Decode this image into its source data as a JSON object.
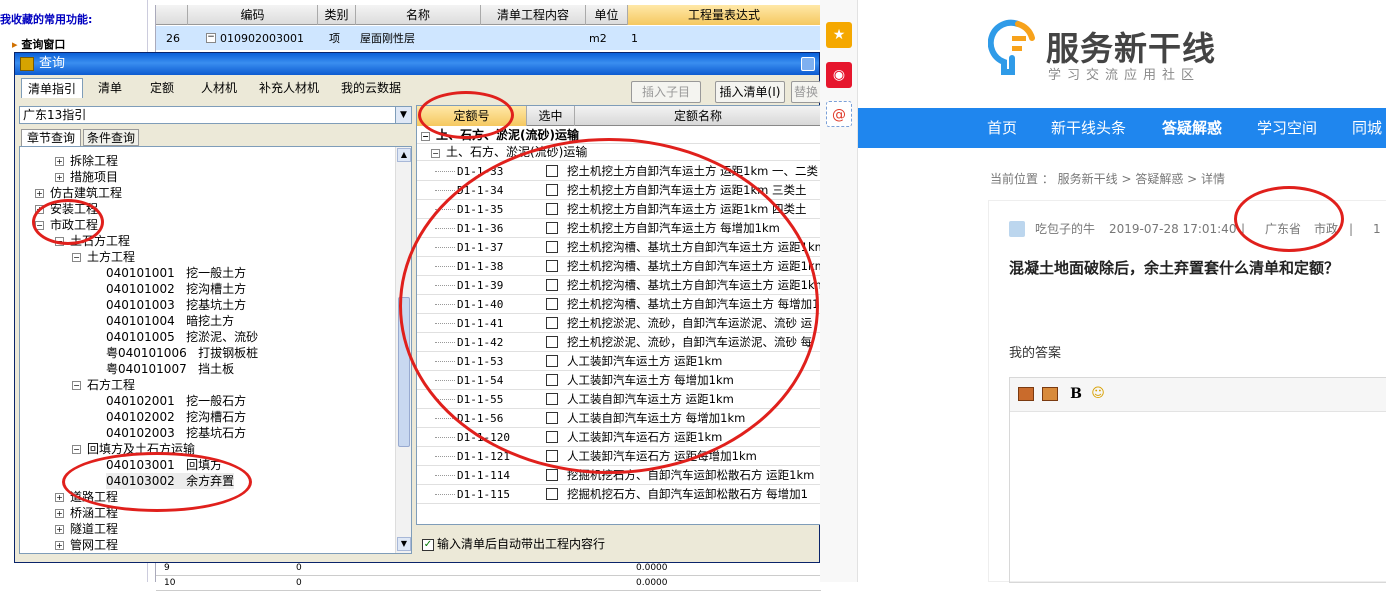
{
  "sidebar": {
    "favorites_title": "我收藏的常用功能:",
    "item": "查询窗口"
  },
  "bg_sheet": {
    "columns": [
      "编码",
      "类别",
      "名称",
      "清单工程内容",
      "单位",
      "工程量表达式"
    ],
    "row": {
      "no": "26",
      "code": "010902003001",
      "type": "项",
      "name": "屋面刚性层",
      "unit": "m2",
      "expr": "1"
    },
    "bottom_rows": [
      {
        "no": "9",
        "val": "0",
        "amt": "0.0000"
      },
      {
        "no": "10",
        "val": "0",
        "amt": "0.0000"
      }
    ]
  },
  "dialog": {
    "title": "查询",
    "tabs": [
      "清单指引",
      "清单",
      "定额",
      "人材机",
      "补充人材机",
      "我的云数据"
    ],
    "buttons": [
      "插入子目",
      "插入清单(I)",
      "替换"
    ],
    "region": "广东13指引",
    "subtabs": [
      "章节查询",
      "条件查询"
    ],
    "tree": [
      {
        "label": "拆除工程",
        "exp": "+"
      },
      {
        "label": "措施项目",
        "exp": "+"
      },
      {
        "label": "仿古建筑工程",
        "exp": "+"
      },
      {
        "label": "安装工程",
        "exp": "+"
      },
      {
        "label": "市政工程",
        "exp": "-"
      },
      {
        "label": "土石方工程",
        "exp": "-"
      },
      {
        "label": "土方工程",
        "exp": "-"
      },
      {
        "label": "040101001   挖一般土方"
      },
      {
        "label": "040101002   挖沟槽土方"
      },
      {
        "label": "040101003   挖基坑土方"
      },
      {
        "label": "040101004   暗挖土方"
      },
      {
        "label": "040101005   挖淤泥、流砂"
      },
      {
        "label": "粤040101006   打拔钢板桩"
      },
      {
        "label": "粤040101007   挡土板"
      },
      {
        "label": "石方工程",
        "exp": "-"
      },
      {
        "label": "040102001   挖一般石方"
      },
      {
        "label": "040102002   挖沟槽石方"
      },
      {
        "label": "040102003   挖基坑石方"
      },
      {
        "label": "回填方及土石方运输",
        "exp": "-"
      },
      {
        "label": "040103001   回填方"
      },
      {
        "label": "040103002   余方弃置"
      },
      {
        "label": "道路工程",
        "exp": "+"
      },
      {
        "label": "桥涵工程",
        "exp": "+"
      },
      {
        "label": "隧道工程",
        "exp": "+"
      },
      {
        "label": "管网工程",
        "exp": "+"
      }
    ],
    "quota": {
      "headers": [
        "定额号",
        "选中",
        "定额名称"
      ],
      "group1": "土、石方、淤泥(流砂)运输",
      "group2": "土、石方、淤泥(流砂)运输",
      "rows": [
        {
          "code": "D1-1-33",
          "name": "挖土机挖土方自卸汽车运土方 运距1km 一、二类"
        },
        {
          "code": "D1-1-34",
          "name": "挖土机挖土方自卸汽车运土方 运距1km 三类土"
        },
        {
          "code": "D1-1-35",
          "name": "挖土机挖土方自卸汽车运土方 运距1km 四类土"
        },
        {
          "code": "D1-1-36",
          "name": "挖土机挖土方自卸汽车运土方 每增加1km"
        },
        {
          "code": "D1-1-37",
          "name": "挖土机挖沟槽、基坑土方自卸汽车运土方 运距1km"
        },
        {
          "code": "D1-1-38",
          "name": "挖土机挖沟槽、基坑土方自卸汽车运土方 运距1km"
        },
        {
          "code": "D1-1-39",
          "name": "挖土机挖沟槽、基坑土方自卸汽车运土方 运距1km"
        },
        {
          "code": "D1-1-40",
          "name": "挖土机挖沟槽、基坑土方自卸汽车运土方 每增加1"
        },
        {
          "code": "D1-1-41",
          "name": "挖土机挖淤泥、流砂，自卸汽车运淤泥、流砂 运"
        },
        {
          "code": "D1-1-42",
          "name": "挖土机挖淤泥、流砂，自卸汽车运淤泥、流砂 每"
        },
        {
          "code": "D1-1-53",
          "name": "人工装卸汽车运土方 运距1km"
        },
        {
          "code": "D1-1-54",
          "name": "人工装卸汽车运土方 每增加1km"
        },
        {
          "code": "D1-1-55",
          "name": "人工装自卸汽车运土方 运距1km"
        },
        {
          "code": "D1-1-56",
          "name": "人工装自卸汽车运土方 每增加1km"
        },
        {
          "code": "D1-1-120",
          "name": "人工装卸汽车运石方 运距1km"
        },
        {
          "code": "D1-1-121",
          "name": "人工装卸汽车运石方 运距每增加1km"
        },
        {
          "code": "D1-1-114",
          "name": "挖掘机挖石方、自卸汽车运卸松散石方 运距1km"
        },
        {
          "code": "D1-1-115",
          "name": "挖掘机挖石方、自卸汽车运卸松散石方 每增加1"
        }
      ]
    },
    "auto_option": "输入清单后自动带出工程内容行"
  },
  "site": {
    "logo_name": "服务新干线",
    "logo_sub": "学习交流应用社区",
    "nav": [
      "首页",
      "新干线头条",
      "答疑解惑",
      "学习空间",
      "同城"
    ],
    "breadcrumb": "当前位置 ： 服务新干线 > 答疑解惑 > 详情",
    "author": "吃包子的牛",
    "datetime": "2019-07-28 17:01:40",
    "region": "广东省",
    "category": "市政",
    "count": "1",
    "question": "混凝土地面破除后，余土弃置套什么清单和定额？",
    "answer_label": "我的答案",
    "editor_bold": "B"
  },
  "colors": {
    "accent_red": "#e0201c",
    "nav_blue": "#1f86ee",
    "title_blue": "#0a5fd8"
  }
}
